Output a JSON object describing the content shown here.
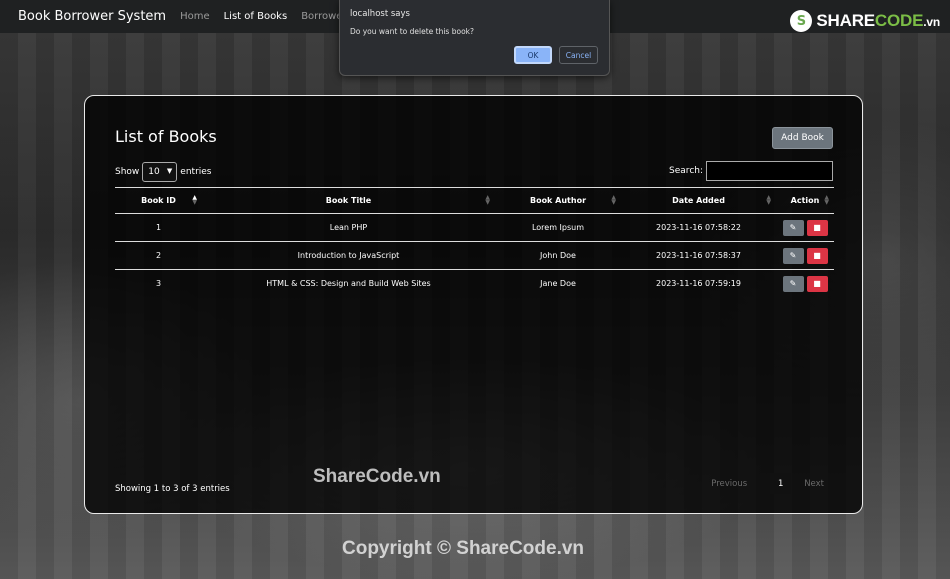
{
  "navbar": {
    "brand": "Book Borrower System",
    "links": [
      {
        "label": "Home",
        "active": false
      },
      {
        "label": "List of Books",
        "active": true
      },
      {
        "label": "Borrowed",
        "active": false
      }
    ]
  },
  "logo": {
    "prefix": "SHARE",
    "accent": "CODE",
    "tld": ".vn",
    "mark": "S"
  },
  "dialog": {
    "origin": "localhost says",
    "message": "Do you want to delete this book?",
    "ok_label": "OK",
    "cancel_label": "Cancel"
  },
  "card": {
    "title": "List of Books",
    "add_label": "Add Book",
    "show_label": "Show",
    "entries_value": "10",
    "entries_label": "entries",
    "search_label": "Search:",
    "columns": [
      "Book ID",
      "Book Title",
      "Book Author",
      "Date Added",
      "Action"
    ],
    "rows": [
      {
        "id": "1",
        "title": "Lean PHP",
        "author": "Lorem Ipsum",
        "date": "2023-11-16 07:58:22"
      },
      {
        "id": "2",
        "title": "Introduction to JavaScript",
        "author": "John Doe",
        "date": "2023-11-16 07:58:37"
      },
      {
        "id": "3",
        "title": "HTML & CSS: Design and Build Web Sites",
        "author": "Jane Doe",
        "date": "2023-11-16 07:59:19"
      }
    ],
    "info": "Showing 1 to 3 of 3 entries",
    "pager": {
      "prev": "Previous",
      "page": "1",
      "next": "Next"
    }
  },
  "watermark": "ShareCode.vn",
  "copyright": "Copyright © ShareCode.vn",
  "icons": {
    "edit": "pencil-icon",
    "delete": "trash-icon"
  },
  "colors": {
    "edit": "#6c757d",
    "delete": "#dc3545",
    "ok": "#8ab4f8"
  }
}
